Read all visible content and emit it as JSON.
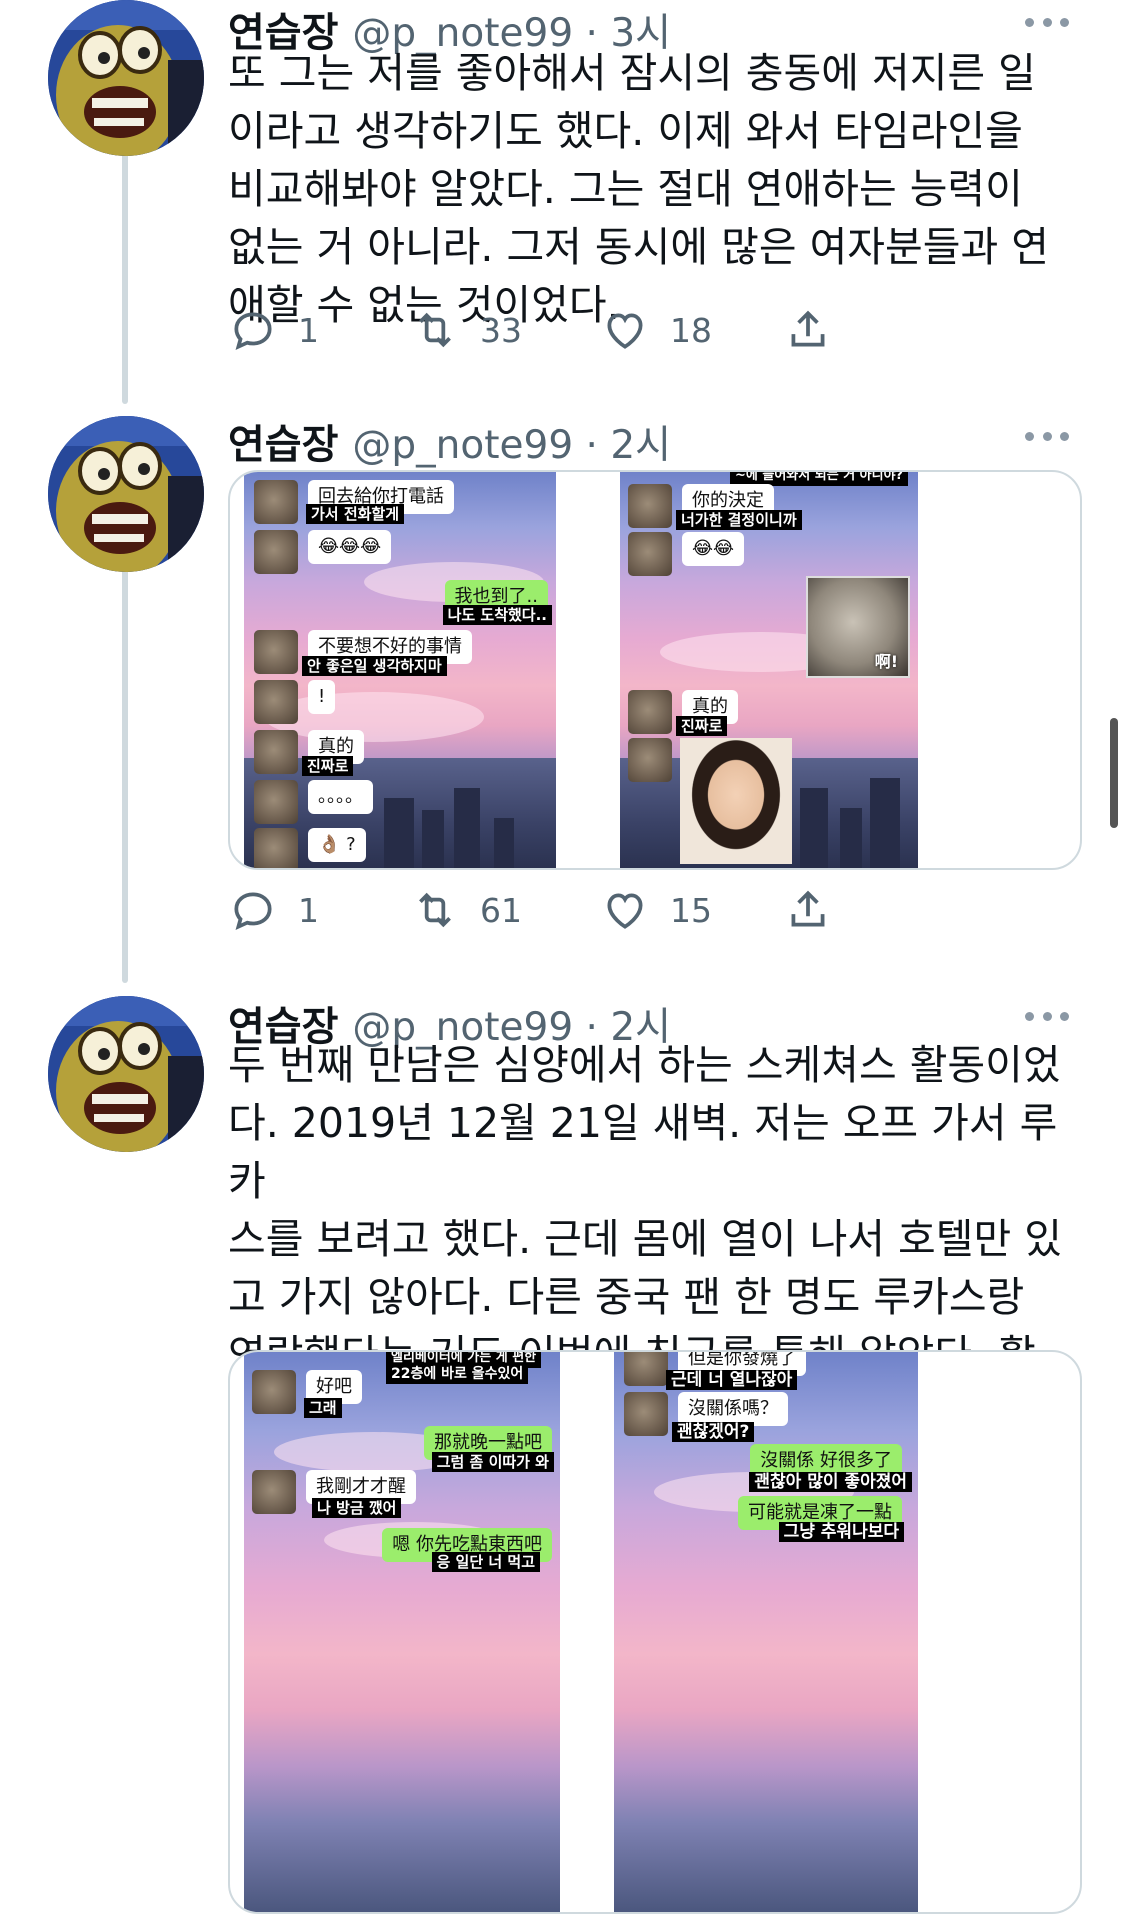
{
  "tweets": [
    {
      "name": "연습장",
      "handle": "@p_note99 · 3시",
      "text": "또 그는 저를 좋아해서 잠시의 충동에 저지른 일\n이라고 생각하기도 했다. 이제 와서 타임라인을\n비교해봐야 알았다. 그는 절대 연애하는 능력이\n없는 거 아니라. 그저 동시에 많은 여자분들과 연\n애할 수 없는 것이었다.",
      "replies": "1",
      "retweets": "33",
      "likes": "18"
    },
    {
      "name": "연습장",
      "handle": "@p_note99 · 2시",
      "replies": "1",
      "retweets": "61",
      "likes": "15",
      "media_left": {
        "m1_cn": "回去給你打電話",
        "m1_kr": "가서 전화할게",
        "m2": "😂😂😂",
        "m3_cn": "我也到了..",
        "m3_kr": "나도 도착했다..",
        "m4_cn": "不要想不好的事情",
        "m4_kr": "안 좋은일 생각하지마",
        "m5": "!",
        "m6_cn": "真的",
        "m6_kr": "진짜로",
        "m7": "。。。。",
        "m8": "👌🏽 ?"
      },
      "media_right": {
        "top_cut": "~에 들어와서 되는 거 아니야?",
        "m1_cn": "你的決定",
        "m1_kr": "너가한 결정이니까",
        "m2": "😂😂",
        "sticker_text": "啊!",
        "m3_cn": "真的",
        "m3_kr": "진짜로"
      }
    },
    {
      "name": "연습장",
      "handle": "@p_note99 · 2시",
      "text": "두 번째 만남은 심양에서 하는 스케쳐스 활동이었\n다. 2019년 12월 21일 새벽. 저는 오프 가서 루카\n스를 보려고 했다. 근데 몸에 열이 나서 호텔만 있\n고 가지 않아다. 다른 중국 팬 한 명도 루카스랑\n연락했다는 거도 이번에 친구를 통해 알았다. 활\n동 끝난 뒤 루카스는 밤에 저 찾으러 왔었다.",
      "media_left": {
        "top_cut1": "엘리베이터에 가는 게 편한",
        "top_cut2": "22층에 바로 올수있어",
        "m1_cn": "好吧",
        "m1_kr": "그래",
        "m2_cn": "那就晚一點吧",
        "m2_kr": "그럼 좀 이따가 와",
        "m3_cn": "我剛才才醒",
        "m3_kr": "나 방금 깼어",
        "m4_cn": "嗯 你先吃點東西吧",
        "m4_kr": "응 일단 너 먹고"
      },
      "media_right": {
        "m1_cn": "但是你發燒了",
        "m1_kr": "근데 너 열나잖아",
        "m2_cn": "沒關係嗎？",
        "m2_kr": "괜찮겠어?",
        "m3_cn": "沒關係 好很多了",
        "m3_kr": "괜찮아 많이 좋아졌어",
        "m4_cn": "可能就是凍了一點",
        "m4_kr": "그냥 추워나보다"
      }
    }
  ],
  "colors": {
    "accent_grey": "#536471",
    "thread_line": "#cfd9de",
    "chat_green": "#9bed6c"
  }
}
